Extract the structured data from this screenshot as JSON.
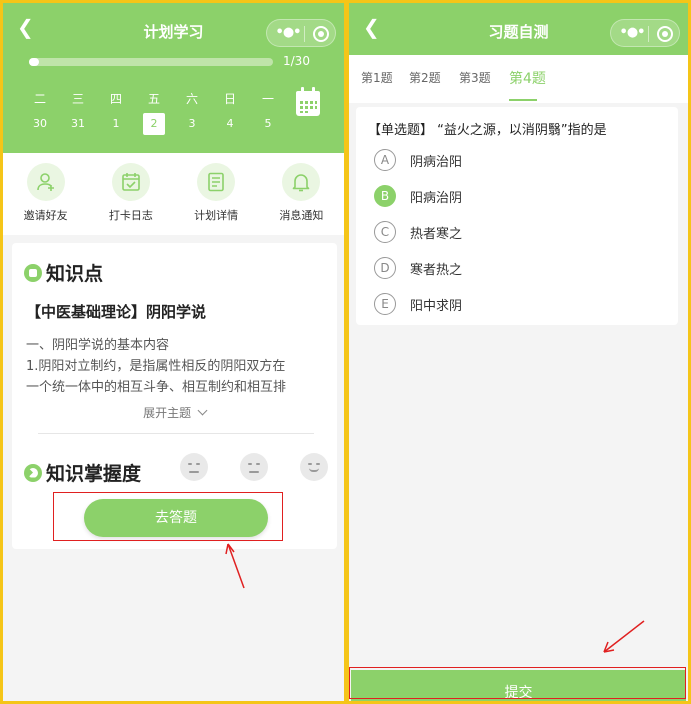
{
  "left": {
    "header": {
      "back_icon": "chevron-left-icon",
      "title": "计划学习"
    },
    "progress": {
      "value": 1,
      "total": 30,
      "label": "1/30"
    },
    "week": [
      {
        "day": "二",
        "date": "30",
        "selected": false
      },
      {
        "day": "三",
        "date": "31",
        "selected": false
      },
      {
        "day": "四",
        "date": "1",
        "selected": false
      },
      {
        "day": "五",
        "date": "2",
        "selected": true
      },
      {
        "day": "六",
        "date": "3",
        "selected": false
      },
      {
        "day": "日",
        "date": "4",
        "selected": false
      },
      {
        "day": "一",
        "date": "5",
        "selected": false
      }
    ],
    "menu": [
      {
        "label": "邀请好友",
        "icon": "add-user-icon"
      },
      {
        "label": "打卡日志",
        "icon": "checkin-calendar-icon"
      },
      {
        "label": "计划详情",
        "icon": "document-icon"
      },
      {
        "label": "消息通知",
        "icon": "bell-icon"
      }
    ],
    "knowledge": {
      "title": "知识点",
      "subtitle": "【中医基础理论】阴阳学说",
      "lines": [
        "一、阴阳学说的基本内容",
        "1.阴阳对立制约，是指属性相反的阴阳双方在",
        "一个统一体中的相互斗争、相互制约和相互排"
      ],
      "expand_label": "展开主题"
    },
    "mastery": {
      "title": "知识掌握度"
    },
    "go_button": "去答题"
  },
  "right": {
    "header": {
      "back_icon": "chevron-left-icon",
      "title": "习题自测"
    },
    "tabs": [
      {
        "label": "第1题",
        "active": false
      },
      {
        "label": "第2题",
        "active": false
      },
      {
        "label": "第3题",
        "active": false
      },
      {
        "label": "第4题",
        "active": true
      }
    ],
    "question": "【单选题】 “益火之源，以消阴翳”指的是",
    "options": [
      {
        "letter": "A",
        "text": "阴病治阳",
        "selected": false
      },
      {
        "letter": "B",
        "text": "阳病治阴",
        "selected": true
      },
      {
        "letter": "C",
        "text": "热者寒之",
        "selected": false
      },
      {
        "letter": "D",
        "text": "寒者热之",
        "selected": false
      },
      {
        "letter": "E",
        "text": "阳中求阴",
        "selected": false
      }
    ],
    "submit_button": "提交"
  },
  "colors": {
    "brand_green": "#8cd16a",
    "frame_yellow": "#f5c518",
    "annotation_red": "#e02020"
  }
}
